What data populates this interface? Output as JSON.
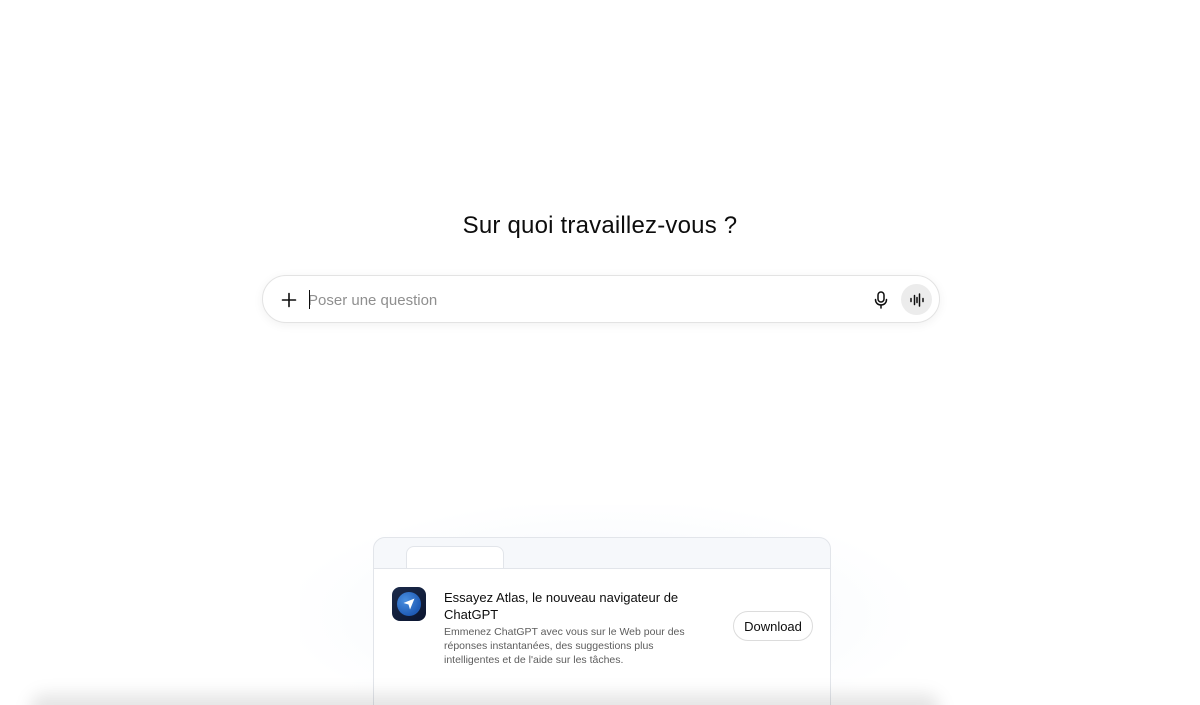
{
  "main": {
    "heading": "Sur quoi travaillez-vous ?"
  },
  "composer": {
    "placeholder": "Poser une question",
    "icons": {
      "add": "plus-icon",
      "dictate": "microphone-icon",
      "voice": "voice-waveform-icon"
    }
  },
  "promo": {
    "icon": "atlas-navigator-icon",
    "title": "Essayez Atlas, le nouveau navigateur de ChatGPT",
    "description": "Emmenez ChatGPT avec vous sur le Web pour des réponses instantanées, des suggestions plus intelligentes et de l'aide sur les tâches.",
    "download_label": "Download"
  },
  "colors": {
    "background": "#ffffff",
    "text": "#0d0d0d",
    "placeholder": "#8f8f8f",
    "voice_button_bg": "#ececec",
    "app_icon_bg": "#0b1530",
    "app_icon_accent": "#2f72cf"
  }
}
